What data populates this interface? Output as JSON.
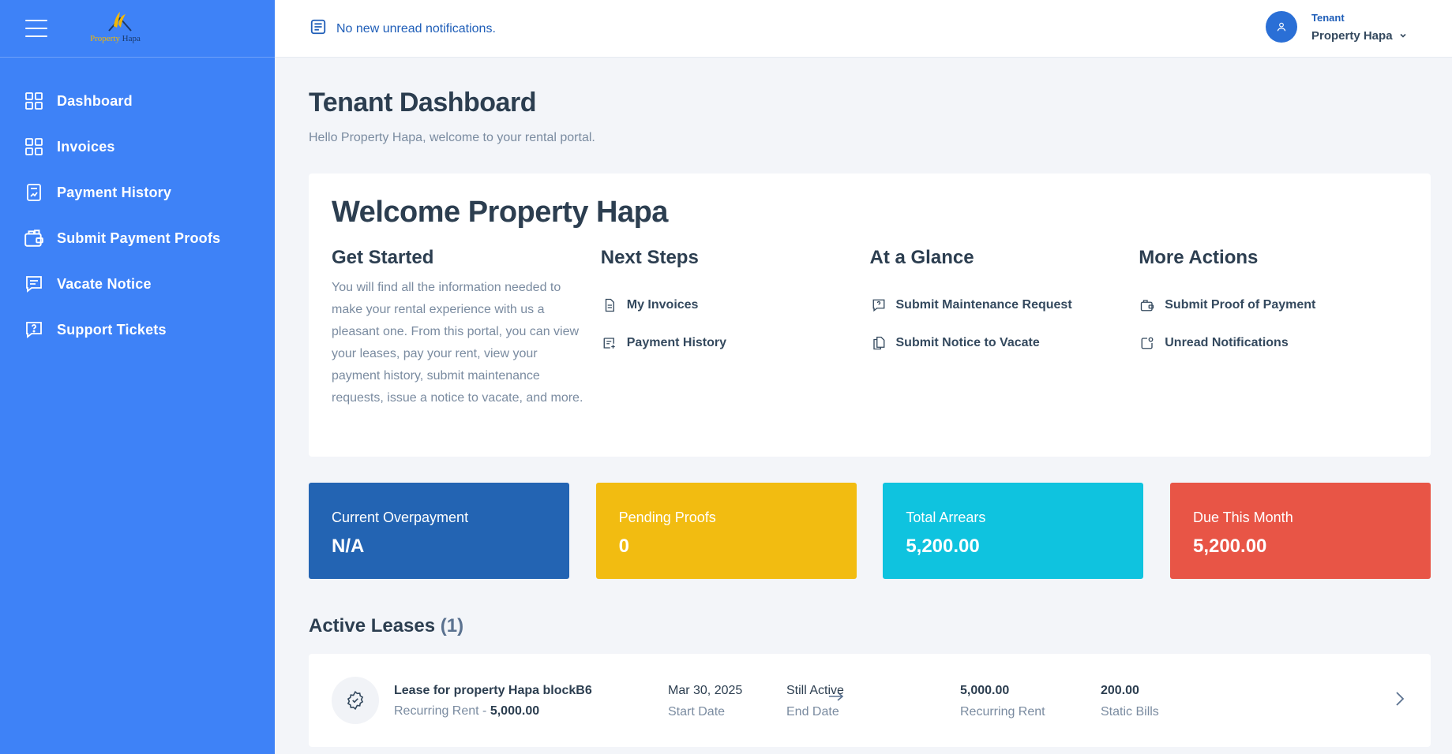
{
  "brand": {
    "logo_part1": "Property",
    "logo_part2": " Hapa"
  },
  "sidebar": {
    "items": [
      {
        "label": "Dashboard",
        "icon": "grid-icon"
      },
      {
        "label": "Invoices",
        "icon": "grid-icon"
      },
      {
        "label": "Payment History",
        "icon": "receipt-chart-icon"
      },
      {
        "label": "Submit Payment Proofs",
        "icon": "wallet-icon"
      },
      {
        "label": "Vacate Notice",
        "icon": "message-lines-icon"
      },
      {
        "label": "Support Tickets",
        "icon": "message-question-icon"
      }
    ]
  },
  "topbar": {
    "notification_text": "No new unread notifications.",
    "user_role": "Tenant",
    "user_name": "Property Hapa"
  },
  "page": {
    "title": "Tenant Dashboard",
    "subtitle": "Hello Property Hapa, welcome to your rental portal."
  },
  "welcome": {
    "title": "Welcome Property Hapa",
    "get_started": {
      "heading": "Get Started",
      "text": "You will find all the information needed to make your rental experience with us a pleasant one. From this portal, you can view your leases, pay your rent, view your payment history, submit maintenance requests, issue a notice to vacate, and more."
    },
    "next_steps": {
      "heading": "Next Steps",
      "links": [
        {
          "label": "My Invoices",
          "icon": "document-icon"
        },
        {
          "label": "Payment History",
          "icon": "receipt-add-icon"
        }
      ]
    },
    "at_a_glance": {
      "heading": "At a Glance",
      "links": [
        {
          "label": "Submit Maintenance Request",
          "icon": "message-question-icon"
        },
        {
          "label": "Submit Notice to Vacate",
          "icon": "document-copy-icon"
        }
      ]
    },
    "more_actions": {
      "heading": "More Actions",
      "links": [
        {
          "label": "Submit Proof of Payment",
          "icon": "wallet-icon"
        },
        {
          "label": "Unread Notifications",
          "icon": "notification-icon"
        }
      ]
    }
  },
  "stats": [
    {
      "label": "Current Overpayment",
      "value": "N/A",
      "color": "#2364b3"
    },
    {
      "label": "Pending Proofs",
      "value": "0",
      "color": "#f2bc11"
    },
    {
      "label": "Total Arrears",
      "value": "5,200.00",
      "color": "#0fc3df"
    },
    {
      "label": "Due This Month",
      "value": "5,200.00",
      "color": "#e85546"
    }
  ],
  "leases": {
    "title": "Active Leases",
    "count": "(1)",
    "items": [
      {
        "name": "Lease for property Hapa blockB6",
        "rent_prefix": "Recurring Rent - ",
        "rent_value": "5,000.00",
        "start_date": "Mar 30, 2025",
        "start_label": "Start Date",
        "end_value": "Still Active",
        "end_label": "End Date",
        "recurring_value": "5,000.00",
        "recurring_label": "Recurring Rent",
        "static_value": "200.00",
        "static_label": "Static Bills"
      }
    ]
  },
  "colors": {
    "sidebar": "#3e82f7",
    "accent": "#1f5eb8",
    "background": "#f3f5f9"
  }
}
